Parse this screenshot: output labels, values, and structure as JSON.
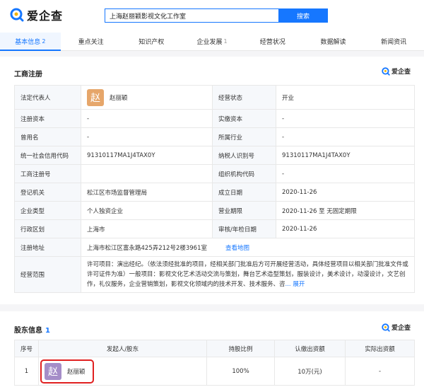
{
  "header": {
    "brand": "爱企查",
    "search_value": "上海赵丽颖影视文化工作室",
    "search_button": "搜索"
  },
  "tabs": [
    {
      "label": "基本信息",
      "count": "2",
      "active": true
    },
    {
      "label": "重点关注",
      "count": ""
    },
    {
      "label": "知识产权",
      "count": ""
    },
    {
      "label": "企业发展",
      "count": "1"
    },
    {
      "label": "经营状况",
      "count": ""
    },
    {
      "label": "数据解读",
      "count": ""
    },
    {
      "label": "新闻资讯",
      "count": ""
    }
  ],
  "business": {
    "title": "工商注册",
    "badge": "爱企查",
    "rows": [
      {
        "l1": "法定代表人",
        "v1": "赵丽颖",
        "l2": "经营状态",
        "v2": "开业"
      },
      {
        "l1": "注册资本",
        "v1": "-",
        "l2": "实缴资本",
        "v2": "-"
      },
      {
        "l1": "曾用名",
        "v1": "-",
        "l2": "所属行业",
        "v2": "-"
      },
      {
        "l1": "统一社会信用代码",
        "v1": "91310117MA1J4TAX0Y",
        "l2": "纳税人识别号",
        "v2": "91310117MA1J4TAX0Y"
      },
      {
        "l1": "工商注册号",
        "v1": "",
        "l2": "组织机构代码",
        "v2": "-"
      },
      {
        "l1": "登记机关",
        "v1": "松江区市场监督管理局",
        "l2": "成立日期",
        "v2": "2020-11-26"
      },
      {
        "l1": "企业类型",
        "v1": "个人独资企业",
        "l2": "营业期限",
        "v2": "2020-11-26 至 无固定期限"
      },
      {
        "l1": "行政区划",
        "v1": "上海市",
        "l2": "审核/年检日期",
        "v2": "2020-11-26"
      }
    ],
    "rep_avatar": "赵",
    "address_label": "注册地址",
    "address_value": "上海市松江区富永路425弄212号2楼3961室",
    "map_link": "查看地图",
    "scope_label": "经营范围",
    "scope_value": "许可项目：演出经纪。（依法须经批准的项目，经相关部门批准后方可开展经营活动，具体经营项目以相关部门批准文件或许可证件为准）一般项目：影视文化艺术活动交流与策划，舞台艺术造型策划，服装设计，美术设计，动漫设计，文艺创作，礼仪服务，企业营销策划，影视文化领域内的技术开发、技术服务、咨",
    "scope_more": "... 展开"
  },
  "shareholders": {
    "title": "股东信息",
    "count": "1",
    "badge": "爱企查",
    "headers": [
      "序号",
      "发起人/股东",
      "持股比例",
      "认缴出资额",
      "实际出资额"
    ],
    "rows": [
      {
        "index": "1",
        "avatar": "赵",
        "name": "赵丽颖",
        "ratio": "100%",
        "subscribed": "10万(元)",
        "actual": "-"
      }
    ]
  },
  "colors": {
    "primary": "#1677ff",
    "highlight": "#e02020"
  }
}
